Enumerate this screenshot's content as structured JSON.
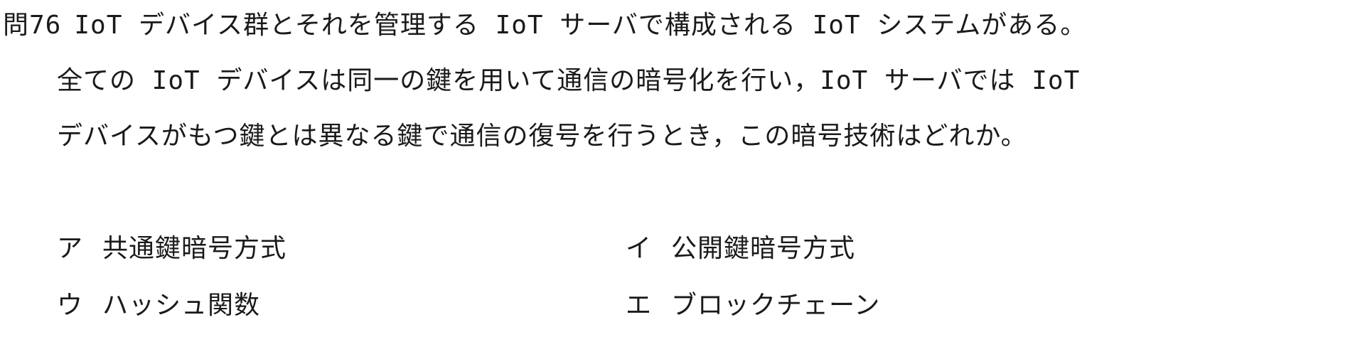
{
  "question": {
    "number": "問76",
    "lines": [
      "IoT デバイス群とそれを管理する IoT サーバで構成される IoT システムがある。",
      "全ての IoT デバイスは同一の鍵を用いて通信の暗号化を行い，IoT サーバでは IoT",
      "デバイスがもつ鍵とは異なる鍵で通信の復号を行うとき，この暗号技術はどれか。"
    ]
  },
  "choices": [
    {
      "label": "ア",
      "text": "共通鍵暗号方式"
    },
    {
      "label": "イ",
      "text": "公開鍵暗号方式"
    },
    {
      "label": "ウ",
      "text": "ハッシュ関数"
    },
    {
      "label": "エ",
      "text": "ブロックチェーン"
    }
  ]
}
